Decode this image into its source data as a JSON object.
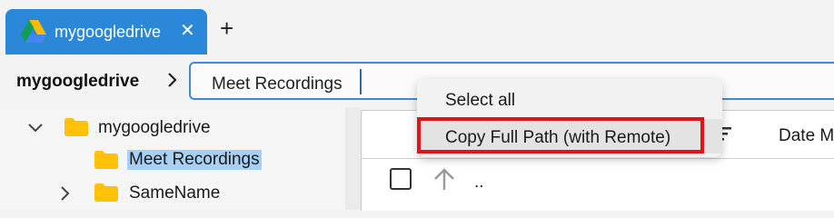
{
  "tabs": [
    {
      "label": "mygoogledrive",
      "active": true,
      "icon": "google-drive-icon"
    }
  ],
  "tab_close_glyph": "✕",
  "new_tab_glyph": "+",
  "breadcrumb": {
    "root": "mygoogledrive",
    "separator_icon": "chevron-right-icon"
  },
  "path_input": {
    "value": "Meet Recordings"
  },
  "tree": {
    "items": [
      {
        "label": "mygoogledrive",
        "expanded": true,
        "selected": false
      },
      {
        "label": "Meet Recordings",
        "expanded": false,
        "selected": true
      },
      {
        "label": "SameName",
        "expanded": false,
        "selected": false
      }
    ]
  },
  "file_list": {
    "columns": {
      "date": "Date M"
    },
    "rows": [
      {
        "name": ".."
      }
    ]
  },
  "context_menu": {
    "items": [
      {
        "label": "Select all"
      },
      {
        "label": "Copy Full Path (with Remote)",
        "highlighted": true
      }
    ]
  },
  "colors": {
    "tab_active": "#2b88d8",
    "selection": "#a8d0f5",
    "folder": "#ffc107",
    "highlight_border": "#e0141b",
    "input_border": "#3d8bd8"
  }
}
